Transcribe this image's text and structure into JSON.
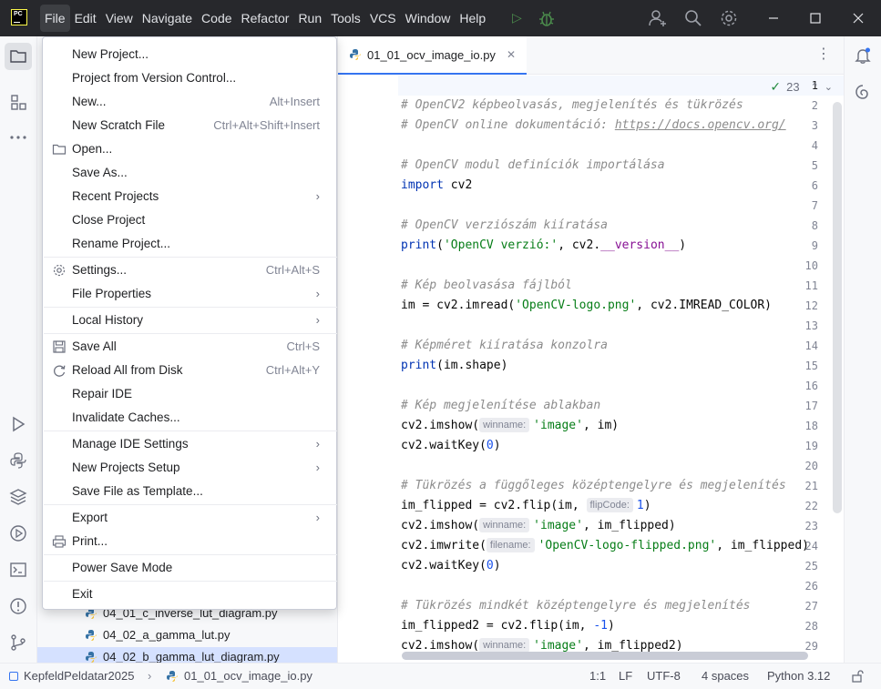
{
  "titlebar": {
    "app_logo": "PC",
    "menus": [
      "File",
      "Edit",
      "View",
      "Navigate",
      "Code",
      "Refactor",
      "Run",
      "Tools",
      "VCS",
      "Window",
      "Help"
    ]
  },
  "file_menu": {
    "items": [
      {
        "label": "New Project...",
        "shortcut": ""
      },
      {
        "label": "Project from Version Control...",
        "shortcut": ""
      },
      {
        "label": "New...",
        "shortcut": "Alt+Insert"
      },
      {
        "label": "New Scratch File",
        "shortcut": "Ctrl+Alt+Shift+Insert"
      },
      {
        "label": "Open...",
        "shortcut": "",
        "icon": "folder-icon"
      },
      {
        "label": "Save As...",
        "shortcut": ""
      },
      {
        "label": "Recent Projects",
        "shortcut": "",
        "submenu": true
      },
      {
        "label": "Close Project",
        "shortcut": ""
      },
      {
        "label": "Rename Project...",
        "shortcut": ""
      },
      {
        "label": "Settings...",
        "shortcut": "Ctrl+Alt+S",
        "icon": "gear-icon"
      },
      {
        "label": "File Properties",
        "shortcut": "",
        "submenu": true
      },
      {
        "label": "Local History",
        "shortcut": "",
        "submenu": true
      },
      {
        "label": "Save All",
        "shortcut": "Ctrl+S",
        "icon": "save-icon"
      },
      {
        "label": "Reload All from Disk",
        "shortcut": "Ctrl+Alt+Y",
        "icon": "reload-icon"
      },
      {
        "label": "Repair IDE",
        "shortcut": ""
      },
      {
        "label": "Invalidate Caches...",
        "shortcut": ""
      },
      {
        "label": "Manage IDE Settings",
        "shortcut": "",
        "submenu": true
      },
      {
        "label": "New Projects Setup",
        "shortcut": "",
        "submenu": true
      },
      {
        "label": "Save File as Template...",
        "shortcut": ""
      },
      {
        "label": "Export",
        "shortcut": "",
        "submenu": true
      },
      {
        "label": "Print...",
        "shortcut": "",
        "icon": "print-icon"
      },
      {
        "label": "Power Save Mode",
        "shortcut": ""
      },
      {
        "label": "Exit",
        "shortcut": ""
      }
    ]
  },
  "project_tree": {
    "files": [
      "04_01_c_inverse_lut_diagram.py",
      "04_02_a_gamma_lut.py",
      "04_02_b_gamma_lut_diagram.py"
    ]
  },
  "editor": {
    "tab": "01_01_ocv_image_io.py",
    "inspection_count": "23",
    "line_numbers": [
      "1",
      "2",
      "3",
      "4",
      "5",
      "6",
      "7",
      "8",
      "9",
      "10",
      "11",
      "12",
      "13",
      "14",
      "15",
      "16",
      "17",
      "18",
      "19",
      "20",
      "21",
      "22",
      "23",
      "24",
      "25",
      "26",
      "27",
      "28",
      "29"
    ],
    "comments": {
      "l2": "# OpenCV2 képbeolvasás, megjelenítés és tükrözés",
      "l3_a": "# OpenCV online dokumentáció: ",
      "l3_url": "https://docs.opencv.org/",
      "l5": "# OpenCV modul definíciók importálása",
      "l8": "# OpenCV verziószám kiíratása",
      "l11": "# Kép beolvasása fájlból",
      "l14": "# Képméret kiíratása konzolra",
      "l17": "# Kép megjelenítése ablakban",
      "l21": "# Tükrözés a függőleges középtengelyre és megjelenítés",
      "l27": "# Tükrözés mindkét középtengelyre és megjelenítés"
    },
    "tokens": {
      "import": "import",
      "cv2": " cv2",
      "print": "print",
      "paren_open": "(",
      "version_str": "'OpenCV verzió:'",
      "version_rest_a": ", cv2.",
      "version_attr": "__version__",
      "paren_close": ")",
      "l12_a": "im = cv2.imread(",
      "l12_str": "'OpenCV-logo.png'",
      "l12_b": ", cv2.IMREAD_COLOR)",
      "l15_b": "(im.shape)",
      "imshow": "cv2.imshow(",
      "hint_winname": "winname:",
      "str_image": "'image'",
      "l18_b": ", im)",
      "waitkey": "cv2.waitKey(",
      "zero": "0",
      "l22_a": "im_flipped = cv2.flip(im, ",
      "hint_flipcode": "flipCode:",
      "one": "1",
      "l23_b": ", im_flipped)",
      "imwrite": "cv2.imwrite(",
      "hint_filename": "filename:",
      "l24_str": "'OpenCV-logo-flipped.png'",
      "l24_b": ", im_flipped)",
      "l28_a": "im_flipped2 = cv2.flip(im, ",
      "minus_one": "-1",
      "l29_b": ", im_flipped2)"
    }
  },
  "statusbar": {
    "project": "KepfeldPeldatar2025",
    "file": "01_01_ocv_image_io.py",
    "position": "1:1",
    "line_ending": "LF",
    "encoding": "UTF-8",
    "indent": "4 spaces",
    "interpreter": "Python 3.12"
  }
}
